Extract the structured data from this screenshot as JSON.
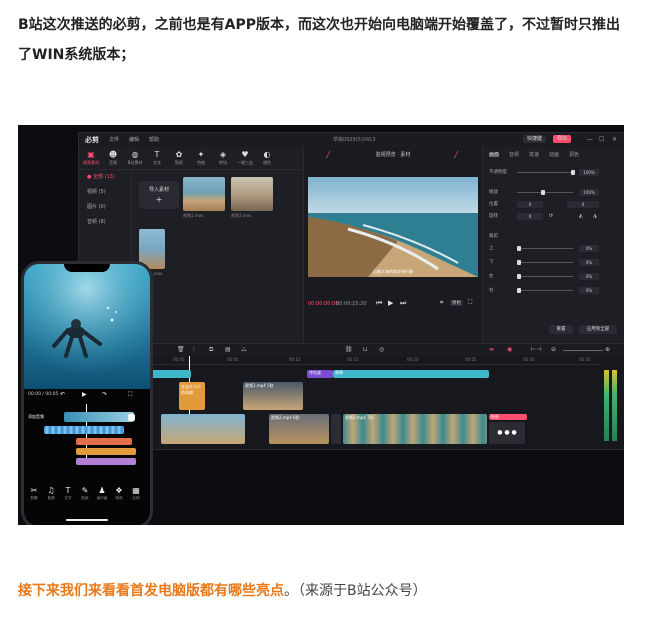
{
  "article": {
    "para1": "B站这次推送的必剪，之前也是有APP版本，而这次也开始向电脑端开始覆盖了，不过暂时只推出了WIN系统版本；",
    "para2_highlight": "接下来我们来看看首发电脑版都有哪些亮点",
    "para2_end": "。（来源于B站公众号）"
  },
  "desktop_app": {
    "brand": "必剪",
    "menus": [
      "文件",
      "编辑",
      "帮助"
    ],
    "project_name": "草稿0929(5)0413",
    "top_buttons": [
      "快捷键",
      "导出"
    ],
    "tools": [
      {
        "glyph": "▣",
        "label": "视频素材"
      },
      {
        "glyph": "☻",
        "label": "音频"
      },
      {
        "glyph": "◍",
        "label": "B站素材"
      },
      {
        "glyph": "T",
        "label": "文本"
      },
      {
        "glyph": "✿",
        "label": "贴纸"
      },
      {
        "glyph": "✦",
        "label": "特效"
      },
      {
        "glyph": "◈",
        "label": "转场"
      },
      {
        "glyph": "♥",
        "label": "一键三连"
      },
      {
        "glyph": "◐",
        "label": "调色"
      }
    ],
    "side_items": [
      "● 全部 (13)",
      "视频 (5)",
      "图片 (0)",
      "音频 (8)"
    ],
    "import_label": "导入素材",
    "import_sub": "+",
    "thumbs": [
      "视频1.mov",
      "视频2.mov",
      "视频-竖.mov"
    ],
    "preview": {
      "title": "监视预览 · 素材",
      "caption": "沿着大海的海岸线行驶",
      "time_current": "00:00:00:00",
      "time_total": "00:00:15:20",
      "ratio": "原始"
    },
    "prop_tabs": [
      "画面",
      "音频",
      "变速",
      "动画",
      "调色"
    ],
    "props": [
      {
        "k": "不透明度",
        "v": "100%"
      },
      {
        "k": "缩放",
        "v": "100%"
      },
      {
        "k": "位置",
        "v": "0"
      },
      {
        "k": "旋转",
        "v": "0"
      },
      {
        "k": "上",
        "v": "0%"
      },
      {
        "k": "下",
        "v": "0%"
      },
      {
        "k": "左",
        "v": "0%"
      },
      {
        "k": "右",
        "v": "0%"
      }
    ],
    "crop_label": "裁剪",
    "reset_label": "重置",
    "apply_all_label": "应用到全部",
    "ruler": [
      "00:00",
      "00:05",
      "00:10",
      "00:15",
      "00:20",
      "00:25",
      "00:30",
      "00:35"
    ],
    "clips": {
      "text_clip": "在这片小小的海滩",
      "effect1": "冲击波",
      "effect2": "故障",
      "video_a": "视频1.mp4  5秒",
      "video_b": "视频2.mp4  6秒",
      "video_c": "视频3.mp4  7秒",
      "sticker": "贴纸",
      "audio": "音乐1.mp3"
    }
  },
  "phone_app": {
    "time": "00:00 / 00:05",
    "track_label": "添加音频",
    "tools": [
      {
        "glyph": "✂",
        "label": "剪辑"
      },
      {
        "glyph": "♫",
        "label": "音频"
      },
      {
        "glyph": "T",
        "label": "文字"
      },
      {
        "glyph": "✎",
        "label": "贴纸"
      },
      {
        "glyph": "♟",
        "label": "画中画"
      },
      {
        "glyph": "❖",
        "label": "特效"
      },
      {
        "glyph": "▦",
        "label": "比例"
      }
    ]
  }
}
